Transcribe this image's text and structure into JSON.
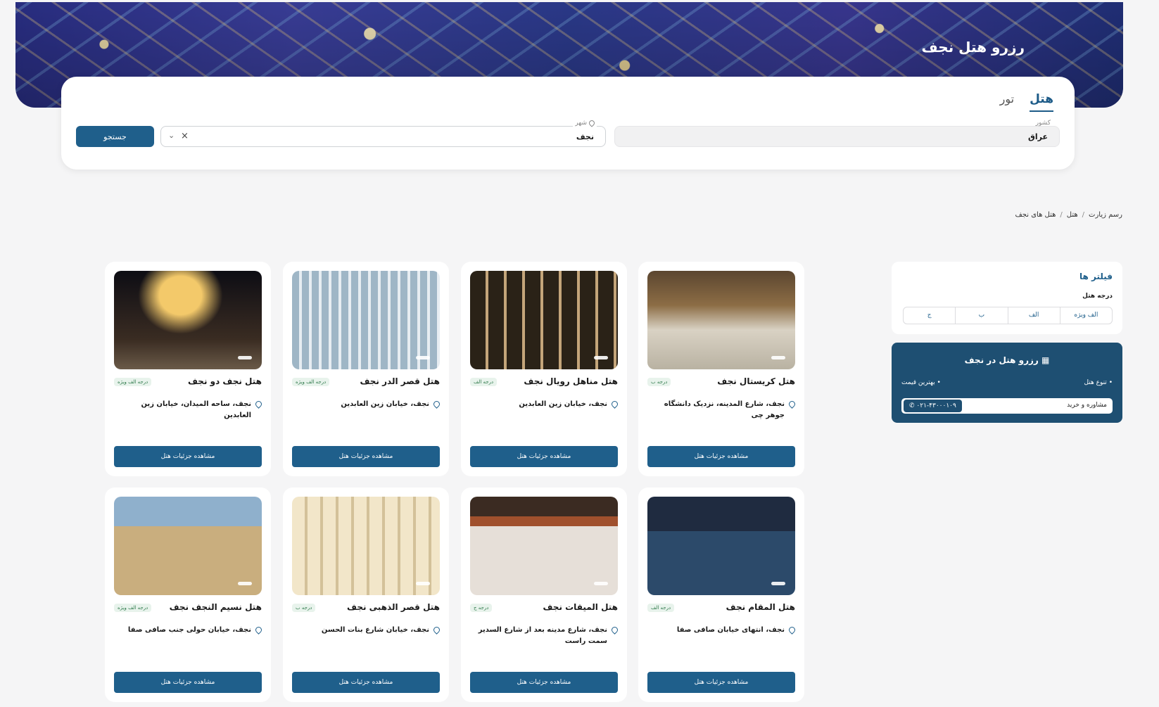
{
  "hero": {
    "title": "رزرو هتل نجف"
  },
  "tabs": [
    {
      "label": "هتل",
      "active": true
    },
    {
      "label": "تور",
      "active": false
    }
  ],
  "search": {
    "country_label": "کشور",
    "country_value": "عراق",
    "city_label": "شهر",
    "city_value": "نجف",
    "button_label": "جستجو"
  },
  "breadcrumb": {
    "items": [
      "رسم زیارت",
      "هتل",
      "هتل های نجف"
    ]
  },
  "filters": {
    "title": "فیلتر ها",
    "grade_label": "درجه هتل",
    "grades": [
      "الف ویژه",
      "الف",
      "ب",
      "ج"
    ]
  },
  "promo": {
    "title": "رزرو هتل در نجف",
    "bullet_1": "تنوع هتل",
    "bullet_2": "بهترین قیمت",
    "consult_label": "مشاوره و خرید",
    "phone": "۰۲۱-۴۳۰۰۰۱۰۹"
  },
  "cards": [
    {
      "name": "هتل کریستال نجف",
      "badge": "درجه ب",
      "location": "نجف، شارع المدینه، نزدیک دانشگاه جوهر چی",
      "button": "مشاهده جزئیات هتل"
    },
    {
      "name": "هتل مناهل رویال نجف",
      "badge": "درجه الف",
      "location": "نجف، خیابان زین العابدین",
      "button": "مشاهده جزئیات هتل"
    },
    {
      "name": "هتل قصر الدر نجف",
      "badge": "درجه الف ویژه",
      "location": "نجف، خیابان زین العابدین",
      "button": "مشاهده جزئیات هتل"
    },
    {
      "name": "هتل نجف دو نجف",
      "badge": "درجه الف ویژه",
      "location": "نجف، ساحه المیدان، خیابان زین العابدین",
      "button": "مشاهده جزئیات هتل"
    },
    {
      "name": "هتل المقام نجف",
      "badge": "درجه الف",
      "location": "نجف، انتهای خیابان صافی صفا",
      "button": "مشاهده جزئیات هتل"
    },
    {
      "name": "هتل المیقات نجف",
      "badge": "درجه ج",
      "location": "نجف، شارع مدینه بعد از شارع السدیر سمت راست",
      "button": "مشاهده جزئیات هتل"
    },
    {
      "name": "هتل قصر الذهبی نجف",
      "badge": "درجه ب",
      "location": "نجف، خیابان شارع بنات الحسن",
      "button": "مشاهده جزئیات هتل"
    },
    {
      "name": "هتل نسیم النجف نجف",
      "badge": "درجه الف ویژه",
      "location": "نجف، خیابان حولی جنب صافی صفا",
      "button": "مشاهده جزئیات هتل"
    }
  ]
}
